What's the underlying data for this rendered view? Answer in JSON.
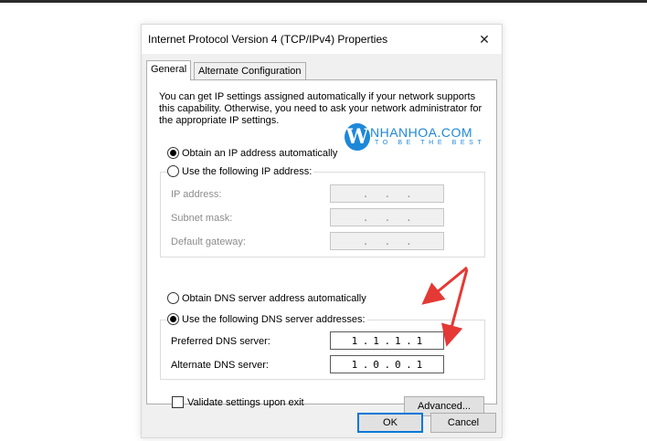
{
  "window": {
    "title": "Internet Protocol Version 4 (TCP/IPv4) Properties",
    "close_glyph": "✕"
  },
  "tabs": [
    {
      "label": "General",
      "active": true
    },
    {
      "label": "Alternate Configuration",
      "active": false
    }
  ],
  "description": "You can get IP settings assigned automatically if your network supports this capability. Otherwise, you need to ask your network administrator for the appropriate IP settings.",
  "ip_section": {
    "auto_label": "Obtain an IP address automatically",
    "auto_selected": true,
    "manual_label": "Use the following IP address:",
    "manual_selected": false,
    "fields": [
      {
        "label": "IP address:",
        "octets": [
          "",
          "",
          "",
          ""
        ]
      },
      {
        "label": "Subnet mask:",
        "octets": [
          "",
          "",
          "",
          ""
        ]
      },
      {
        "label": "Default gateway:",
        "octets": [
          "",
          "",
          "",
          ""
        ]
      }
    ]
  },
  "dns_section": {
    "auto_label": "Obtain DNS server address automatically",
    "auto_selected": false,
    "manual_label": "Use the following DNS server addresses:",
    "manual_selected": true,
    "preferred": {
      "label": "Preferred DNS server:",
      "octets": [
        "1",
        "1",
        "1",
        "1"
      ]
    },
    "alternate": {
      "label": "Alternate DNS server:",
      "octets": [
        "1",
        "0",
        "0",
        "1"
      ]
    }
  },
  "validate": {
    "label": "Validate settings upon exit",
    "checked": false
  },
  "buttons": {
    "advanced": "Advanced...",
    "ok": "OK",
    "cancel": "Cancel"
  },
  "watermark": {
    "letter": "W",
    "name": "NHANHOA.COM",
    "tagline": "TO BE THE BEST"
  },
  "colors": {
    "accent": "#0078d7",
    "watermark": "#1e88d8",
    "annotation_arrow": "#e53935"
  }
}
